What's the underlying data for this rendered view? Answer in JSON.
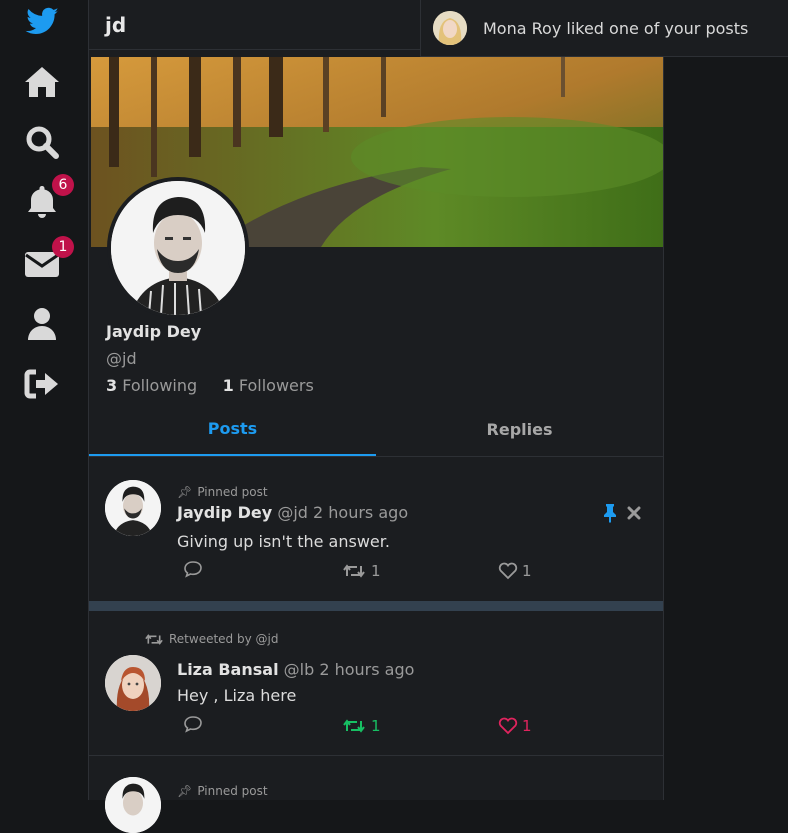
{
  "topbar": {
    "title": "jd"
  },
  "sidebar": {
    "items": [
      {
        "name": "logo"
      },
      {
        "name": "home"
      },
      {
        "name": "search"
      },
      {
        "name": "notifications",
        "badge": "6"
      },
      {
        "name": "messages",
        "badge": "1"
      },
      {
        "name": "profile"
      },
      {
        "name": "logout"
      }
    ]
  },
  "notification": {
    "text": "Mona Roy liked one of your posts"
  },
  "profile": {
    "name": "Jaydip Dey",
    "handle": "@jd",
    "following_count": "3",
    "following_label": "Following",
    "followers_count": "1",
    "followers_label": "Followers"
  },
  "tabs": [
    {
      "label": "Posts",
      "active": true
    },
    {
      "label": "Replies",
      "active": false
    }
  ],
  "posts": [
    {
      "pinned_label": "Pinned post",
      "name": "Jaydip Dey",
      "handle": "@jd",
      "time": "2 hours ago",
      "text": "Giving up isn't the answer.",
      "retweets": "1",
      "likes": "1"
    },
    {
      "retweeted_label": "Retweeted by @jd",
      "name": "Liza Bansal",
      "handle": "@lb",
      "time": "2 hours ago",
      "text": "Hey , Liza here",
      "retweets": "1",
      "likes": "1"
    },
    {
      "pinned_label": "Pinned post"
    }
  ],
  "colors": {
    "accent": "#1d9bf0",
    "badge": "#c0124a",
    "retweet_active": "#17bf63",
    "like_active": "#e0245e"
  }
}
